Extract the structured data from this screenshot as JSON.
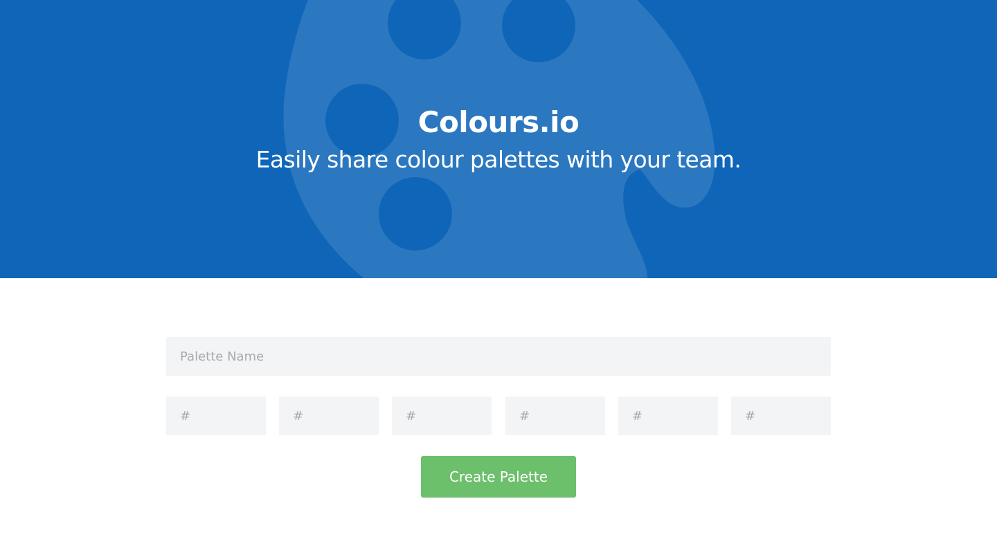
{
  "hero": {
    "title": "Colours.io",
    "subtitle": "Easily share colour palettes with your team.",
    "background_color": "#0f66b8",
    "illustration": "palette-icon"
  },
  "form": {
    "name_placeholder": "Palette Name",
    "hex_placeholders": [
      "#",
      "#",
      "#",
      "#",
      "#",
      "#"
    ],
    "submit_label": "Create Palette",
    "submit_color": "#6cbf6b",
    "input_background": "#f3f4f6"
  }
}
